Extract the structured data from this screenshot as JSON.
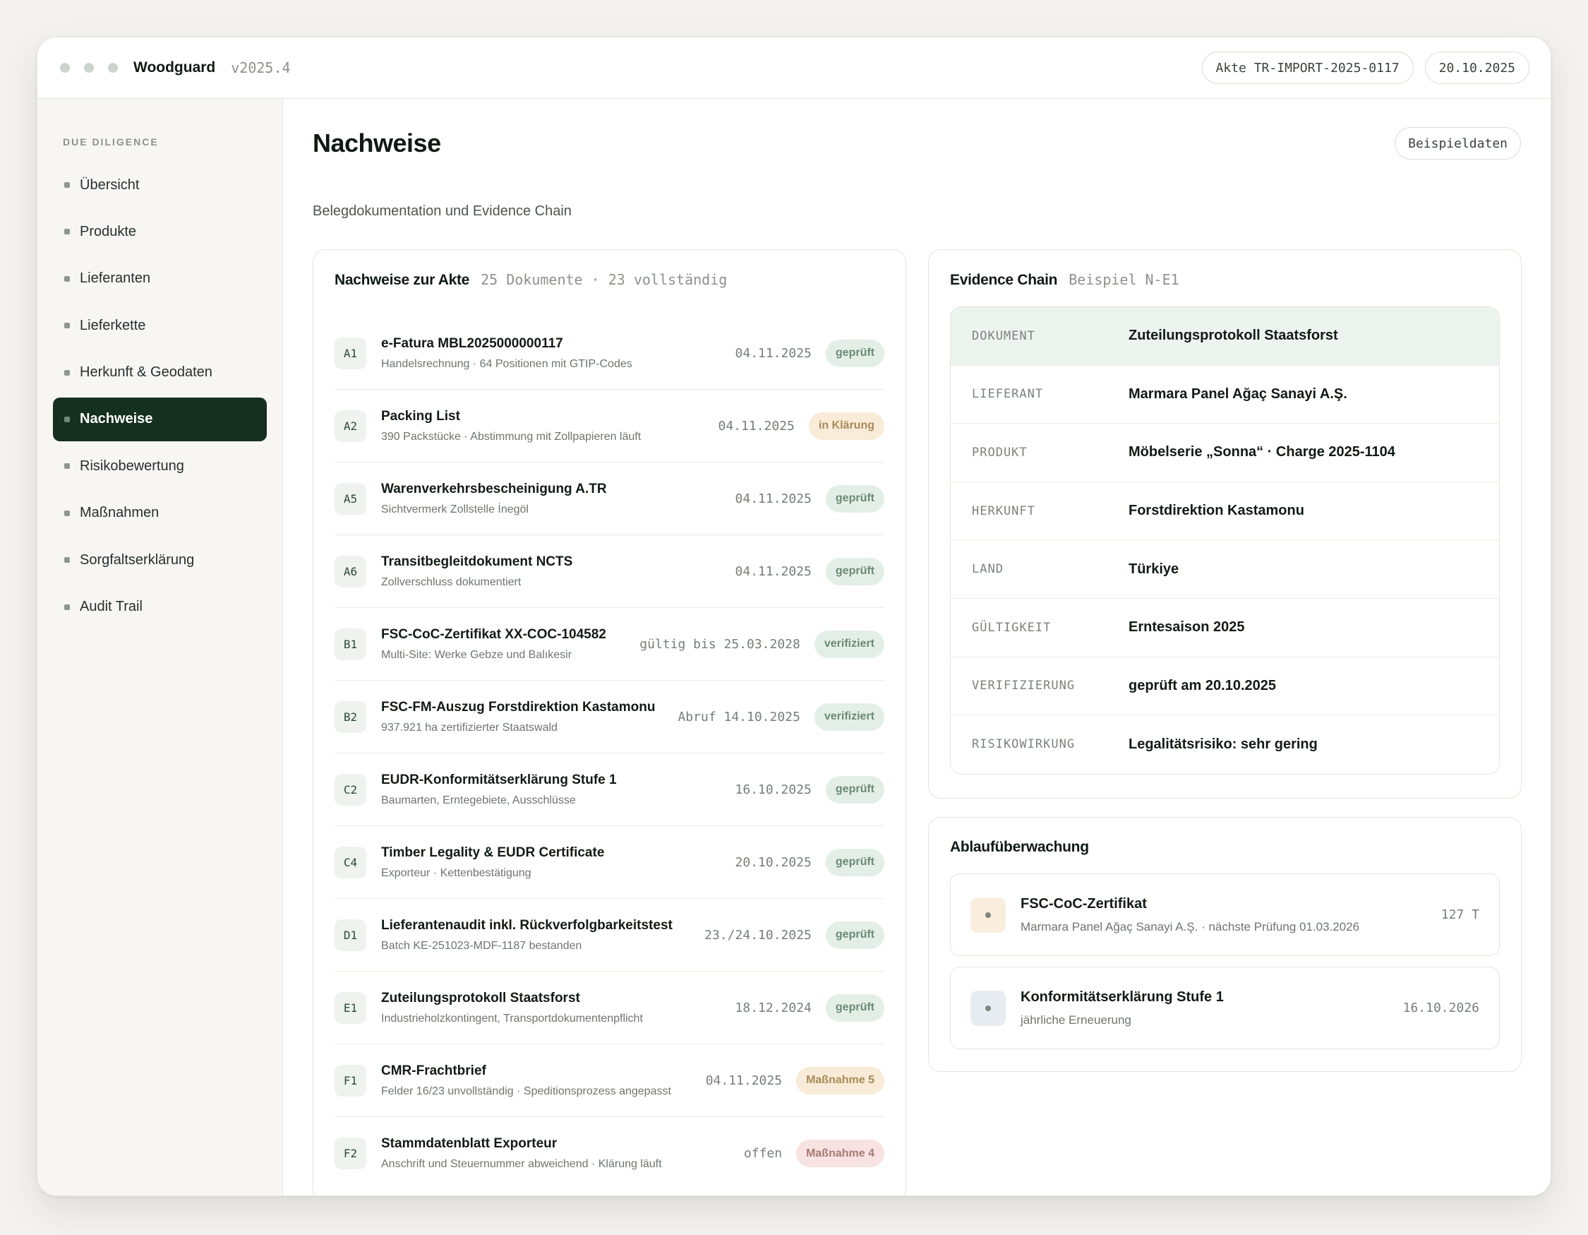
{
  "titlebar": {
    "app_name": "Woodguard",
    "version": "v2025.4",
    "case_pill": "Akte TR-IMPORT-2025-0117",
    "date_pill": "20.10.2025"
  },
  "sidebar": {
    "section": "DUE DILIGENCE",
    "items": [
      {
        "label": "Übersicht"
      },
      {
        "label": "Produkte"
      },
      {
        "label": "Lieferanten"
      },
      {
        "label": "Lieferkette"
      },
      {
        "label": "Herkunft & Geodaten"
      },
      {
        "label": "Nachweise"
      },
      {
        "label": "Risikobewertung"
      },
      {
        "label": "Maßnahmen"
      },
      {
        "label": "Sorgfaltserklärung"
      },
      {
        "label": "Audit Trail"
      }
    ],
    "active": "Nachweise"
  },
  "page": {
    "title": "Nachweise",
    "subtitle": "Belegdokumentation und Evidence Chain",
    "sample_button": "Beispieldaten"
  },
  "documents": {
    "title": "Nachweise zur Akte",
    "meta": "25 Dokumente · 23 vollständig",
    "rows": [
      {
        "code": "A1",
        "title": "e-Fatura MBL2025000000117",
        "sub": "Handelsrechnung · 64 Positionen mit GTIP-Codes",
        "date": "04.11.2025",
        "badge": "geprüft",
        "status": "green"
      },
      {
        "code": "A2",
        "title": "Packing List",
        "sub": "390 Packstücke · Abstimmung mit Zollpapieren läuft",
        "date": "04.11.2025",
        "badge": "in Klärung",
        "status": "amber"
      },
      {
        "code": "A5",
        "title": "Warenverkehrsbescheinigung A.TR",
        "sub": "Sichtvermerk Zollstelle İnegöl",
        "date": "04.11.2025",
        "badge": "geprüft",
        "status": "green"
      },
      {
        "code": "A6",
        "title": "Transitbegleitdokument NCTS",
        "sub": "Zollverschluss dokumentiert",
        "date": "04.11.2025",
        "badge": "geprüft",
        "status": "green"
      },
      {
        "code": "B1",
        "title": "FSC-CoC-Zertifikat XX-COC-104582",
        "sub": "Multi-Site: Werke Gebze und Balıkesir",
        "date": "gültig bis 25.03.2028",
        "badge": "verifiziert",
        "status": "green"
      },
      {
        "code": "B2",
        "title": "FSC-FM-Auszug Forstdirektion Kastamonu",
        "sub": "937.921 ha zertifizierter Staatswald",
        "date": "Abruf 14.10.2025",
        "badge": "verifiziert",
        "status": "green"
      },
      {
        "code": "C2",
        "title": "EUDR-Konformitätserklärung Stufe 1",
        "sub": "Baumarten, Erntegebiete, Ausschlüsse",
        "date": "16.10.2025",
        "badge": "geprüft",
        "status": "green"
      },
      {
        "code": "C4",
        "title": "Timber Legality & EUDR Certificate",
        "sub": "Exporteur · Kettenbestätigung",
        "date": "20.10.2025",
        "badge": "geprüft",
        "status": "green"
      },
      {
        "code": "D1",
        "title": "Lieferantenaudit inkl. Rückverfolgbarkeitstest",
        "sub": "Batch KE-251023-MDF-1187 bestanden",
        "date": "23./24.10.2025",
        "badge": "geprüft",
        "status": "green"
      },
      {
        "code": "E1",
        "title": "Zuteilungsprotokoll Staatsforst",
        "sub": "Industrieholzkontingent, Transportdokumentenpflicht",
        "date": "18.12.2024",
        "badge": "geprüft",
        "status": "green"
      },
      {
        "code": "F1",
        "title": "CMR-Frachtbrief",
        "sub": "Felder 16/23 unvollständig · Speditionsprozess angepasst",
        "date": "04.11.2025",
        "badge": "Maßnahme 5",
        "status": "amber"
      },
      {
        "code": "F2",
        "title": "Stammdatenblatt Exporteur",
        "sub": "Anschrift und Steuernummer abweichend · Klärung läuft",
        "date": "offen",
        "badge": "Maßnahme 4",
        "status": "red"
      }
    ]
  },
  "chain": {
    "title": "Evidence Chain",
    "meta": "Beispiel N-E1",
    "rows": [
      {
        "key": "DOKUMENT",
        "value": "Zuteilungsprotokoll Staatsforst"
      },
      {
        "key": "LIEFERANT",
        "value": "Marmara Panel Ağaç Sanayi A.Ş."
      },
      {
        "key": "PRODUKT",
        "value": "Möbelserie „Sonna“ · Charge 2025-1104"
      },
      {
        "key": "HERKUNFT",
        "value": "Forstdirektion Kastamonu"
      },
      {
        "key": "LAND",
        "value": "Türkiye"
      },
      {
        "key": "GÜLTIGKEIT",
        "value": "Erntesaison 2025"
      },
      {
        "key": "VERIFIZIERUNG",
        "value": "geprüft am 20.10.2025"
      },
      {
        "key": "RISIKOWIRKUNG",
        "value": "Legalitätsrisiko: sehr gering"
      }
    ]
  },
  "watch": {
    "title": "Ablaufüberwachung",
    "items": [
      {
        "title": "FSC-CoC-Zertifikat",
        "sub": "Marmara Panel Ağaç Sanayi A.Ş. · nächste Prüfung 01.03.2026",
        "right": "127 T",
        "tone": "amber"
      },
      {
        "title": "Konformitätserklärung Stufe 1",
        "sub": "jährliche Erneuerung",
        "right": "16.10.2026",
        "tone": "blue"
      }
    ]
  },
  "colors": {
    "accent": "#163020",
    "badge_green": "#e3efe6",
    "badge_amber": "#f8ebd7",
    "badge_red": "#f7e3e1"
  }
}
